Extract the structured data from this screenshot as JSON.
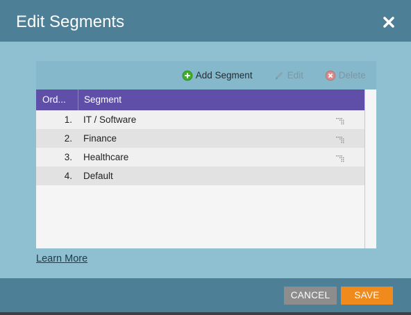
{
  "dialog": {
    "title": "Edit Segments",
    "close_icon": "close-icon"
  },
  "toolbar": {
    "add_label": "Add Segment",
    "edit_label": "Edit",
    "delete_label": "Delete",
    "add_icon": "plus-circle-icon",
    "edit_icon": "pencil-icon",
    "delete_icon": "x-circle-icon"
  },
  "table": {
    "columns": [
      "Ord...",
      "Segment"
    ],
    "rows": [
      {
        "order": "1.",
        "segment": "IT / Software",
        "draggable": true
      },
      {
        "order": "2.",
        "segment": "Finance",
        "draggable": true
      },
      {
        "order": "3.",
        "segment": "Healthcare",
        "draggable": true
      },
      {
        "order": "4.",
        "segment": "Default",
        "draggable": false
      }
    ]
  },
  "learn_more": "Learn More",
  "footer": {
    "cancel_label": "CANCEL",
    "save_label": "SAVE"
  },
  "colors": {
    "titlebar": "#4d7f97",
    "body": "#8fc0d2",
    "header": "#5f4fa8",
    "save": "#f08a1d",
    "cancel": "#8d8d8d"
  }
}
